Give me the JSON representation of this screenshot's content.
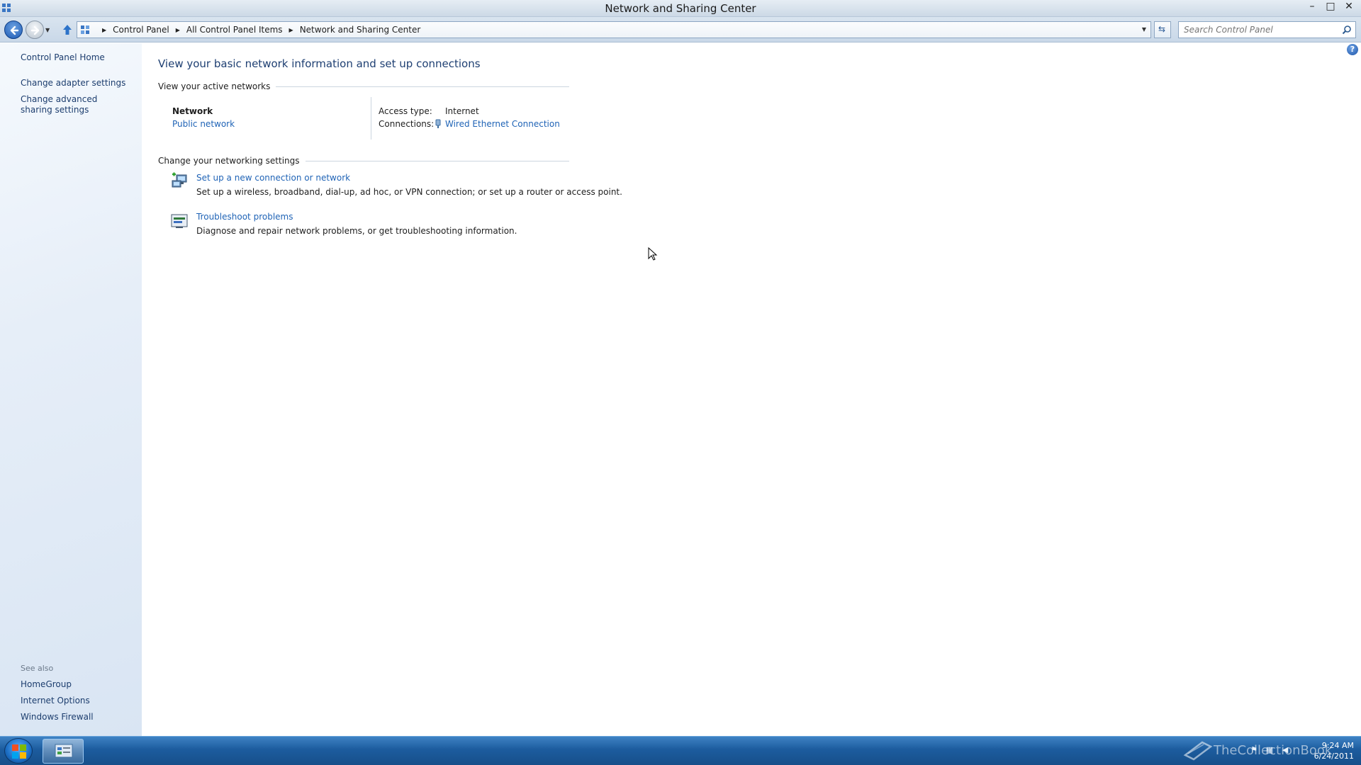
{
  "window": {
    "title": "Network and Sharing Center",
    "minimize_glyph": "–",
    "maximize_glyph": "□",
    "close_glyph": "✕"
  },
  "address_bar": {
    "breadcrumbs": [
      "Control Panel",
      "All Control Panel Items",
      "Network and Sharing Center"
    ],
    "search_placeholder": "Search Control Panel"
  },
  "left_pane": {
    "home": "Control Panel Home",
    "tasks": [
      "Change adapter settings",
      "Change advanced sharing settings"
    ],
    "see_also_label": "See also",
    "see_also": [
      "HomeGroup",
      "Internet Options",
      "Windows Firewall"
    ]
  },
  "main": {
    "heading": "View your basic network information and set up connections",
    "active_networks_label": "View your active networks",
    "network": {
      "name": "Network",
      "category": "Public network",
      "access_type_label": "Access type:",
      "access_type_value": "Internet",
      "connections_label": "Connections:",
      "connection_value": "Wired Ethernet Connection"
    },
    "change_settings_label": "Change your networking settings",
    "tasks": [
      {
        "link": "Set up a new connection or network",
        "description": "Set up a wireless, broadband, dial-up, ad hoc, or VPN connection; or set up a router or access point."
      },
      {
        "link": "Troubleshoot problems",
        "description": "Diagnose and repair network problems, or get troubleshooting information."
      }
    ]
  },
  "taskbar": {
    "watermark": "TheCollectionBook",
    "time": "9:24 AM",
    "date": "6/24/2011"
  },
  "colors": {
    "link": "#1f63b6",
    "heading": "#1e3f72",
    "taskbar": "#1c5c9e"
  }
}
